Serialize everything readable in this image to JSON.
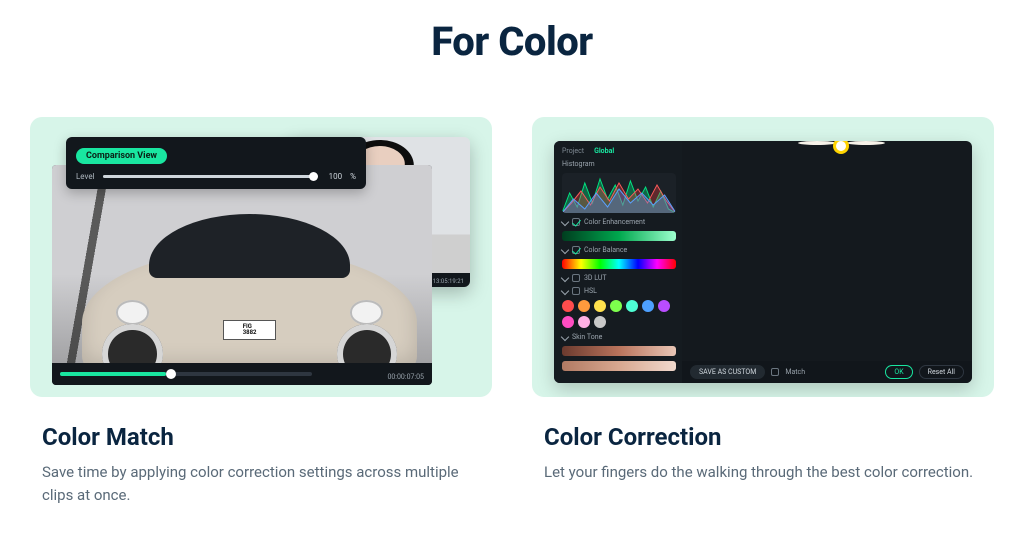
{
  "page": {
    "title": "For Color"
  },
  "cards": [
    {
      "title": "Color Match",
      "description": "Save time by applying color correction settings across multiple clips at once.",
      "mock": {
        "badge": "Comparison View",
        "level_label": "Level",
        "level_value": "100",
        "level_unit": "%",
        "plate_text": "FIG\n3882",
        "main_timecode": "00:00:07:05",
        "secondary_timecode": "13:05:19:21"
      }
    },
    {
      "title": "Color Correction",
      "description": "Let your fingers do the walking through the best color correction.",
      "mock": {
        "tabs": [
          "Project",
          "Global"
        ],
        "section_histogram": "Histogram",
        "row_color_enhance": "Color Enhancement",
        "row_color_balance": "Color Balance",
        "row_lut": "3D LUT",
        "row_hsl": "HSL",
        "row_skin": "Skin Tone",
        "swatch_colors": [
          "#ff4d4d",
          "#ff9a3d",
          "#ffe14d",
          "#7dff4d",
          "#4dffd4",
          "#4da0ff",
          "#b94dff",
          "#ff4dc2",
          "#ffb0e4",
          "#c8c8c8"
        ],
        "save_custom": "SAVE AS CUSTOM",
        "footer_match": "Match",
        "btn_ok": "OK",
        "btn_reset": "Reset All"
      }
    }
  ]
}
